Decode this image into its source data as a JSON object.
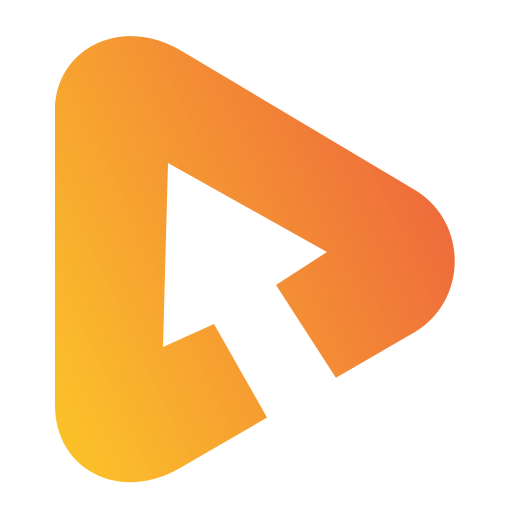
{
  "logo": {
    "icon": "play-cursor-logo-icon",
    "colors": {
      "gradient_start": "#FBBF2A",
      "gradient_end": "#EE6A3C",
      "cutout": "#FFFFFF",
      "background": "#FFFFFF"
    }
  }
}
